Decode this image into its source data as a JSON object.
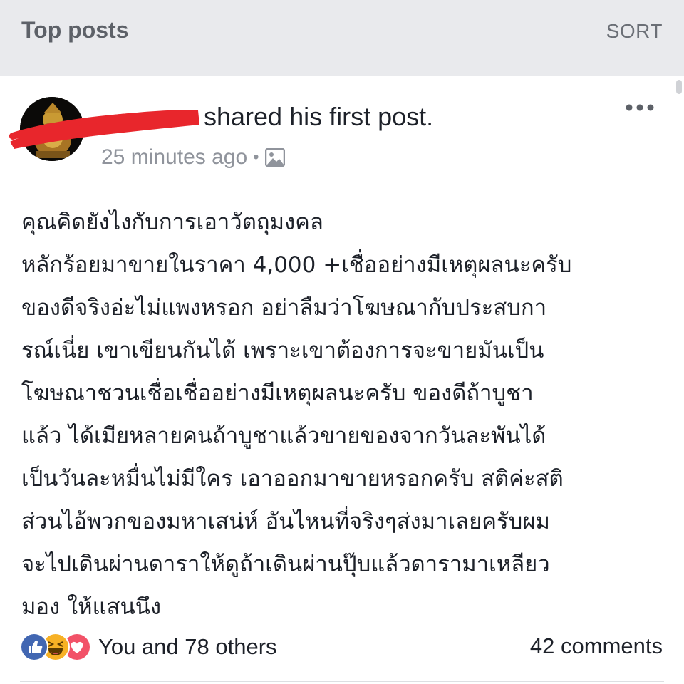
{
  "header": {
    "title": "Top posts",
    "sort_label": "SORT"
  },
  "post": {
    "author_action": "shared his first post.",
    "timestamp": "25 minutes ago",
    "separator": "•",
    "privacy_icon": "photo-icon",
    "more_icon": "more-options-icon",
    "body_lines": [
      "คุณคิดยังไงกับการเอาวัตถุมงคล",
      "หลักร้อยมาขายในราคา 4,000 +เชื่ออย่างมีเหตุผลนะครับ",
      "ของดีจริงอ่ะไม่แพงหรอก อย่าลืมว่าโฆษณากับประสบกา",
      "รณ์เนี่ย เขาเขียนกันได้ เพราะเขาต้องการจะขายมันเป็น",
      "โฆษณาชวนเชื่อเชื่ออย่างมีเหตุผลนะครับ ของดีถ้าบูชา",
      "แล้ว ได้เมียหลายคนถ้าบูชาแล้วขายของจากวันละพันได้",
      "เป็นวันละหมื่นไม่มีใคร เอาออกมาขายหรอกครับ สติค่ะสติ",
      "ส่วนไอ้พวกของมหาเสน่ห์ อันไหนที่จริงๆส่งมาเลยครับผม",
      "จะไปเดินผ่านดาราให้ดูถ้าเดินผ่านปุ๊บแล้วดารามาเหลียว",
      "มอง ให้แสนนึง"
    ]
  },
  "footer": {
    "reactions": [
      "like-icon",
      "haha-icon",
      "love-icon"
    ],
    "reaction_summary": "You and 78 others",
    "comments": "42 comments"
  },
  "colors": {
    "header_bg": "#e9eaed",
    "text": "#1d2129",
    "muted": "#90949c",
    "like": "#4267b2",
    "haha": "#f7b125",
    "love": "#f25268",
    "redaction": "#e8262c"
  }
}
